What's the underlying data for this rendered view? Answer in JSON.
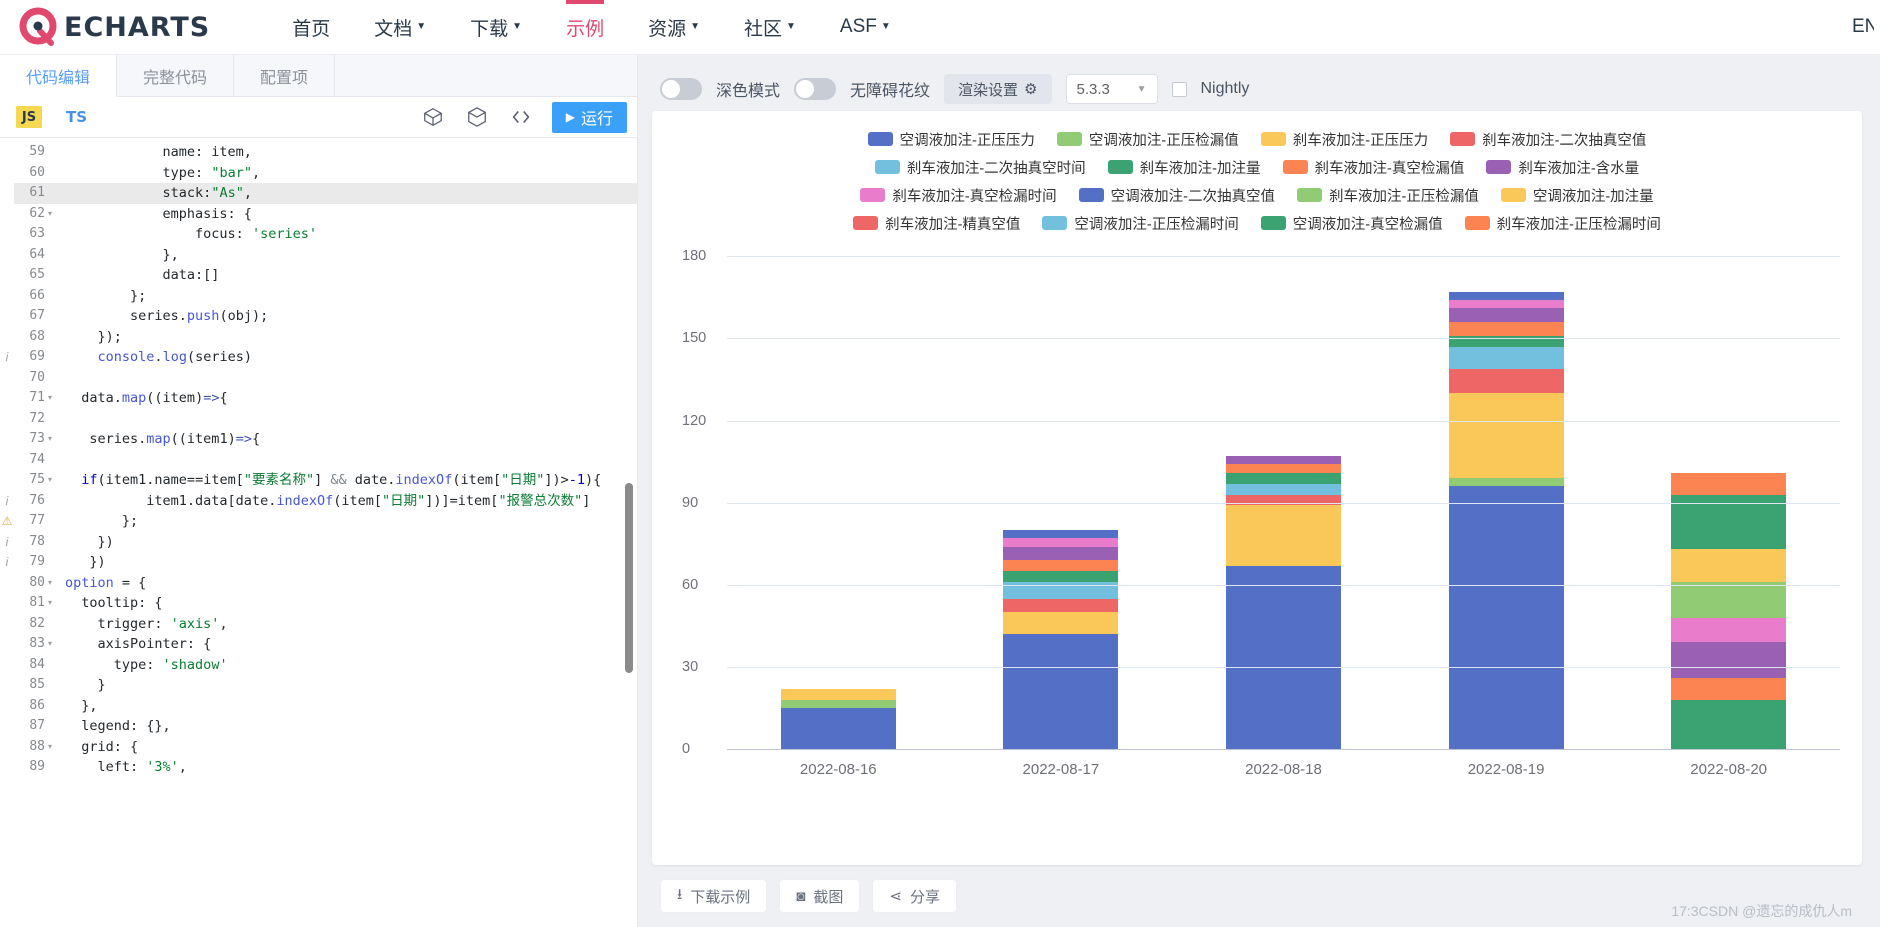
{
  "header": {
    "brand": "ECHARTS",
    "nav": [
      {
        "label": "首页",
        "caret": false,
        "active": false
      },
      {
        "label": "文档",
        "caret": true,
        "active": false
      },
      {
        "label": "下载",
        "caret": true,
        "active": false
      },
      {
        "label": "示例",
        "caret": false,
        "active": true
      },
      {
        "label": "资源",
        "caret": true,
        "active": false
      },
      {
        "label": "社区",
        "caret": true,
        "active": false
      },
      {
        "label": "ASF",
        "caret": true,
        "active": false
      }
    ],
    "lang": "EN",
    "accent": "#e0486e"
  },
  "editor": {
    "tabs": [
      {
        "label": "代码编辑",
        "active": true
      },
      {
        "label": "完整代码",
        "active": false
      },
      {
        "label": "配置项",
        "active": false
      }
    ],
    "lang_js": "JS",
    "lang_ts": "TS",
    "run_label": "运行",
    "icons": [
      "cube-outline-icon",
      "box-icon",
      "code-brackets-icon"
    ],
    "lines": [
      {
        "no": "59",
        "mark": "",
        "fold": "",
        "hl": false,
        "text": "            name: item,"
      },
      {
        "no": "60",
        "mark": "",
        "fold": "",
        "hl": false,
        "text": "            type: \"bar\","
      },
      {
        "no": "61",
        "mark": "",
        "fold": "",
        "hl": true,
        "text": "            stack:\"As\","
      },
      {
        "no": "62",
        "mark": "",
        "fold": "▾",
        "hl": false,
        "text": "            emphasis: {"
      },
      {
        "no": "63",
        "mark": "",
        "fold": "",
        "hl": false,
        "text": "                focus: 'series'"
      },
      {
        "no": "64",
        "mark": "",
        "fold": "",
        "hl": false,
        "text": "            },"
      },
      {
        "no": "65",
        "mark": "",
        "fold": "",
        "hl": false,
        "text": "            data:[]"
      },
      {
        "no": "66",
        "mark": "",
        "fold": "",
        "hl": false,
        "text": "        };"
      },
      {
        "no": "67",
        "mark": "",
        "fold": "",
        "hl": false,
        "text": "        series.push(obj);"
      },
      {
        "no": "68",
        "mark": "",
        "fold": "",
        "hl": false,
        "text": "    });"
      },
      {
        "no": "69",
        "mark": "i",
        "fold": "",
        "hl": false,
        "text": "    console.log(series)"
      },
      {
        "no": "70",
        "mark": "",
        "fold": "",
        "hl": false,
        "text": ""
      },
      {
        "no": "71",
        "mark": "",
        "fold": "▾",
        "hl": false,
        "text": "  data.map((item)=>{"
      },
      {
        "no": "72",
        "mark": "",
        "fold": "",
        "hl": false,
        "text": ""
      },
      {
        "no": "73",
        "mark": "",
        "fold": "▾",
        "hl": false,
        "text": "   series.map((item1)=>{"
      },
      {
        "no": "74",
        "mark": "",
        "fold": "",
        "hl": false,
        "text": ""
      },
      {
        "no": "75",
        "mark": "",
        "fold": "▾",
        "hl": false,
        "text": "  if(item1.name==item[\"要素名称\"] && date.indexOf(item[\"日期\"])>-1){"
      },
      {
        "no": "76",
        "mark": "i",
        "fold": "",
        "hl": false,
        "text": "          item1.data[date.indexOf(item[\"日期\"])]=item[\"报警总次数\"]"
      },
      {
        "no": "77",
        "mark": "warn",
        "fold": "",
        "hl": false,
        "text": "       };"
      },
      {
        "no": "78",
        "mark": "i",
        "fold": "",
        "hl": false,
        "text": "    })"
      },
      {
        "no": "79",
        "mark": "i",
        "fold": "",
        "hl": false,
        "text": "   })"
      },
      {
        "no": "80",
        "mark": "",
        "fold": "▾",
        "hl": false,
        "text": "option = {"
      },
      {
        "no": "81",
        "mark": "",
        "fold": "▾",
        "hl": false,
        "text": "  tooltip: {"
      },
      {
        "no": "82",
        "mark": "",
        "fold": "",
        "hl": false,
        "text": "    trigger: 'axis',"
      },
      {
        "no": "83",
        "mark": "",
        "fold": "▾",
        "hl": false,
        "text": "    axisPointer: {"
      },
      {
        "no": "84",
        "mark": "",
        "fold": "",
        "hl": false,
        "text": "      type: 'shadow'"
      },
      {
        "no": "85",
        "mark": "",
        "fold": "",
        "hl": false,
        "text": "    }"
      },
      {
        "no": "86",
        "mark": "",
        "fold": "",
        "hl": false,
        "text": "  },"
      },
      {
        "no": "87",
        "mark": "",
        "fold": "",
        "hl": false,
        "text": "  legend: {},"
      },
      {
        "no": "88",
        "mark": "",
        "fold": "▾",
        "hl": false,
        "text": "  grid: {"
      },
      {
        "no": "89",
        "mark": "",
        "fold": "",
        "hl": false,
        "text": "    left: '3%',"
      }
    ]
  },
  "preview": {
    "dark_mode_label": "深色模式",
    "accessible_label": "无障碍花纹",
    "render_settings_label": "渲染设置",
    "version": "5.3.3",
    "nightly_label": "Nightly",
    "download_label": "下载示例",
    "screenshot_label": "截图",
    "share_label": "分享",
    "watermark": "17:3CSDN @遗忘的成仇人m"
  },
  "chart_data": {
    "type": "bar",
    "stacked": true,
    "title": "",
    "xlabel": "",
    "ylabel": "",
    "grid": true,
    "legend_position": "top",
    "categories": [
      "2022-08-16",
      "2022-08-17",
      "2022-08-18",
      "2022-08-19",
      "2022-08-20"
    ],
    "yticks": [
      0,
      30,
      60,
      90,
      120,
      150,
      180
    ],
    "ylim": [
      0,
      190
    ],
    "series": [
      {
        "name": "空调液加注-正压压力",
        "color": "#5470c6",
        "values": [
          15,
          42,
          67,
          96,
          0
        ]
      },
      {
        "name": "空调液加注-正压检漏值",
        "color": "#91cc75",
        "values": [
          3,
          0,
          0,
          3,
          0
        ]
      },
      {
        "name": "刹车液加注-正压压力",
        "color": "#fac858",
        "values": [
          4,
          8,
          22,
          31,
          0
        ]
      },
      {
        "name": "刹车液加注-二次抽真空值",
        "color": "#ee6666",
        "values": [
          0,
          5,
          4,
          9,
          0
        ]
      },
      {
        "name": "刹车液加注-二次抽真空时间",
        "color": "#73c0de",
        "values": [
          0,
          6,
          4,
          8,
          0
        ]
      },
      {
        "name": "刹车液加注-加注量",
        "color": "#3ba272",
        "values": [
          0,
          4,
          4,
          4,
          18
        ]
      },
      {
        "name": "刹车液加注-真空检漏值",
        "color": "#fc8452",
        "values": [
          0,
          4,
          3,
          5,
          8
        ]
      },
      {
        "name": "刹车液加注-含水量",
        "color": "#9a60b4",
        "values": [
          0,
          5,
          3,
          5,
          13
        ]
      },
      {
        "name": "刹车液加注-真空检漏时间",
        "color": "#ea7ccc",
        "values": [
          0,
          3,
          0,
          3,
          9
        ]
      },
      {
        "name": "空调液加注-二次抽真空值",
        "color": "#5470c6",
        "values": [
          0,
          3,
          0,
          3,
          0
        ]
      },
      {
        "name": "刹车液加注-正压检漏值",
        "color": "#91cc75",
        "values": [
          0,
          0,
          0,
          0,
          13
        ]
      },
      {
        "name": "空调液加注-加注量",
        "color": "#fac858",
        "values": [
          0,
          0,
          0,
          0,
          12
        ]
      },
      {
        "name": "刹车液加注-精真空值",
        "color": "#ee6666",
        "values": [
          0,
          0,
          0,
          0,
          0
        ]
      },
      {
        "name": "空调液加注-正压检漏时间",
        "color": "#73c0de",
        "values": [
          0,
          0,
          0,
          0,
          0
        ]
      },
      {
        "name": "空调液加注-真空检漏值",
        "color": "#3ba272",
        "values": [
          0,
          0,
          0,
          0,
          20
        ]
      },
      {
        "name": "刹车液加注-正压检漏时间",
        "color": "#fc8452",
        "values": [
          0,
          0,
          0,
          0,
          8
        ]
      }
    ],
    "legend_rows": [
      [
        {
          "name": "空调液加注-正压压力",
          "color": "#5470c6"
        },
        {
          "name": "空调液加注-正压检漏值",
          "color": "#91cc75"
        },
        {
          "name": "刹车液加注-正压压力",
          "color": "#fac858"
        },
        {
          "name": "刹车液加注-二次抽真空值",
          "color": "#ee6666"
        }
      ],
      [
        {
          "name": "刹车液加注-二次抽真空时间",
          "color": "#73c0de"
        },
        {
          "name": "刹车液加注-加注量",
          "color": "#3ba272"
        },
        {
          "name": "刹车液加注-真空检漏值",
          "color": "#fc8452"
        },
        {
          "name": "刹车液加注-含水量",
          "color": "#9a60b4"
        }
      ],
      [
        {
          "name": "刹车液加注-真空检漏时间",
          "color": "#ea7ccc"
        },
        {
          "name": "空调液加注-二次抽真空值",
          "color": "#5470c6"
        },
        {
          "name": "刹车液加注-正压检漏值",
          "color": "#91cc75"
        },
        {
          "name": "空调液加注-加注量",
          "color": "#fac858"
        }
      ],
      [
        {
          "name": "刹车液加注-精真空值",
          "color": "#ee6666"
        },
        {
          "name": "空调液加注-正压检漏时间",
          "color": "#73c0de"
        },
        {
          "name": "空调液加注-真空检漏值",
          "color": "#3ba272"
        },
        {
          "name": "刹车液加注-正压检漏时间",
          "color": "#fc8452"
        }
      ]
    ]
  }
}
